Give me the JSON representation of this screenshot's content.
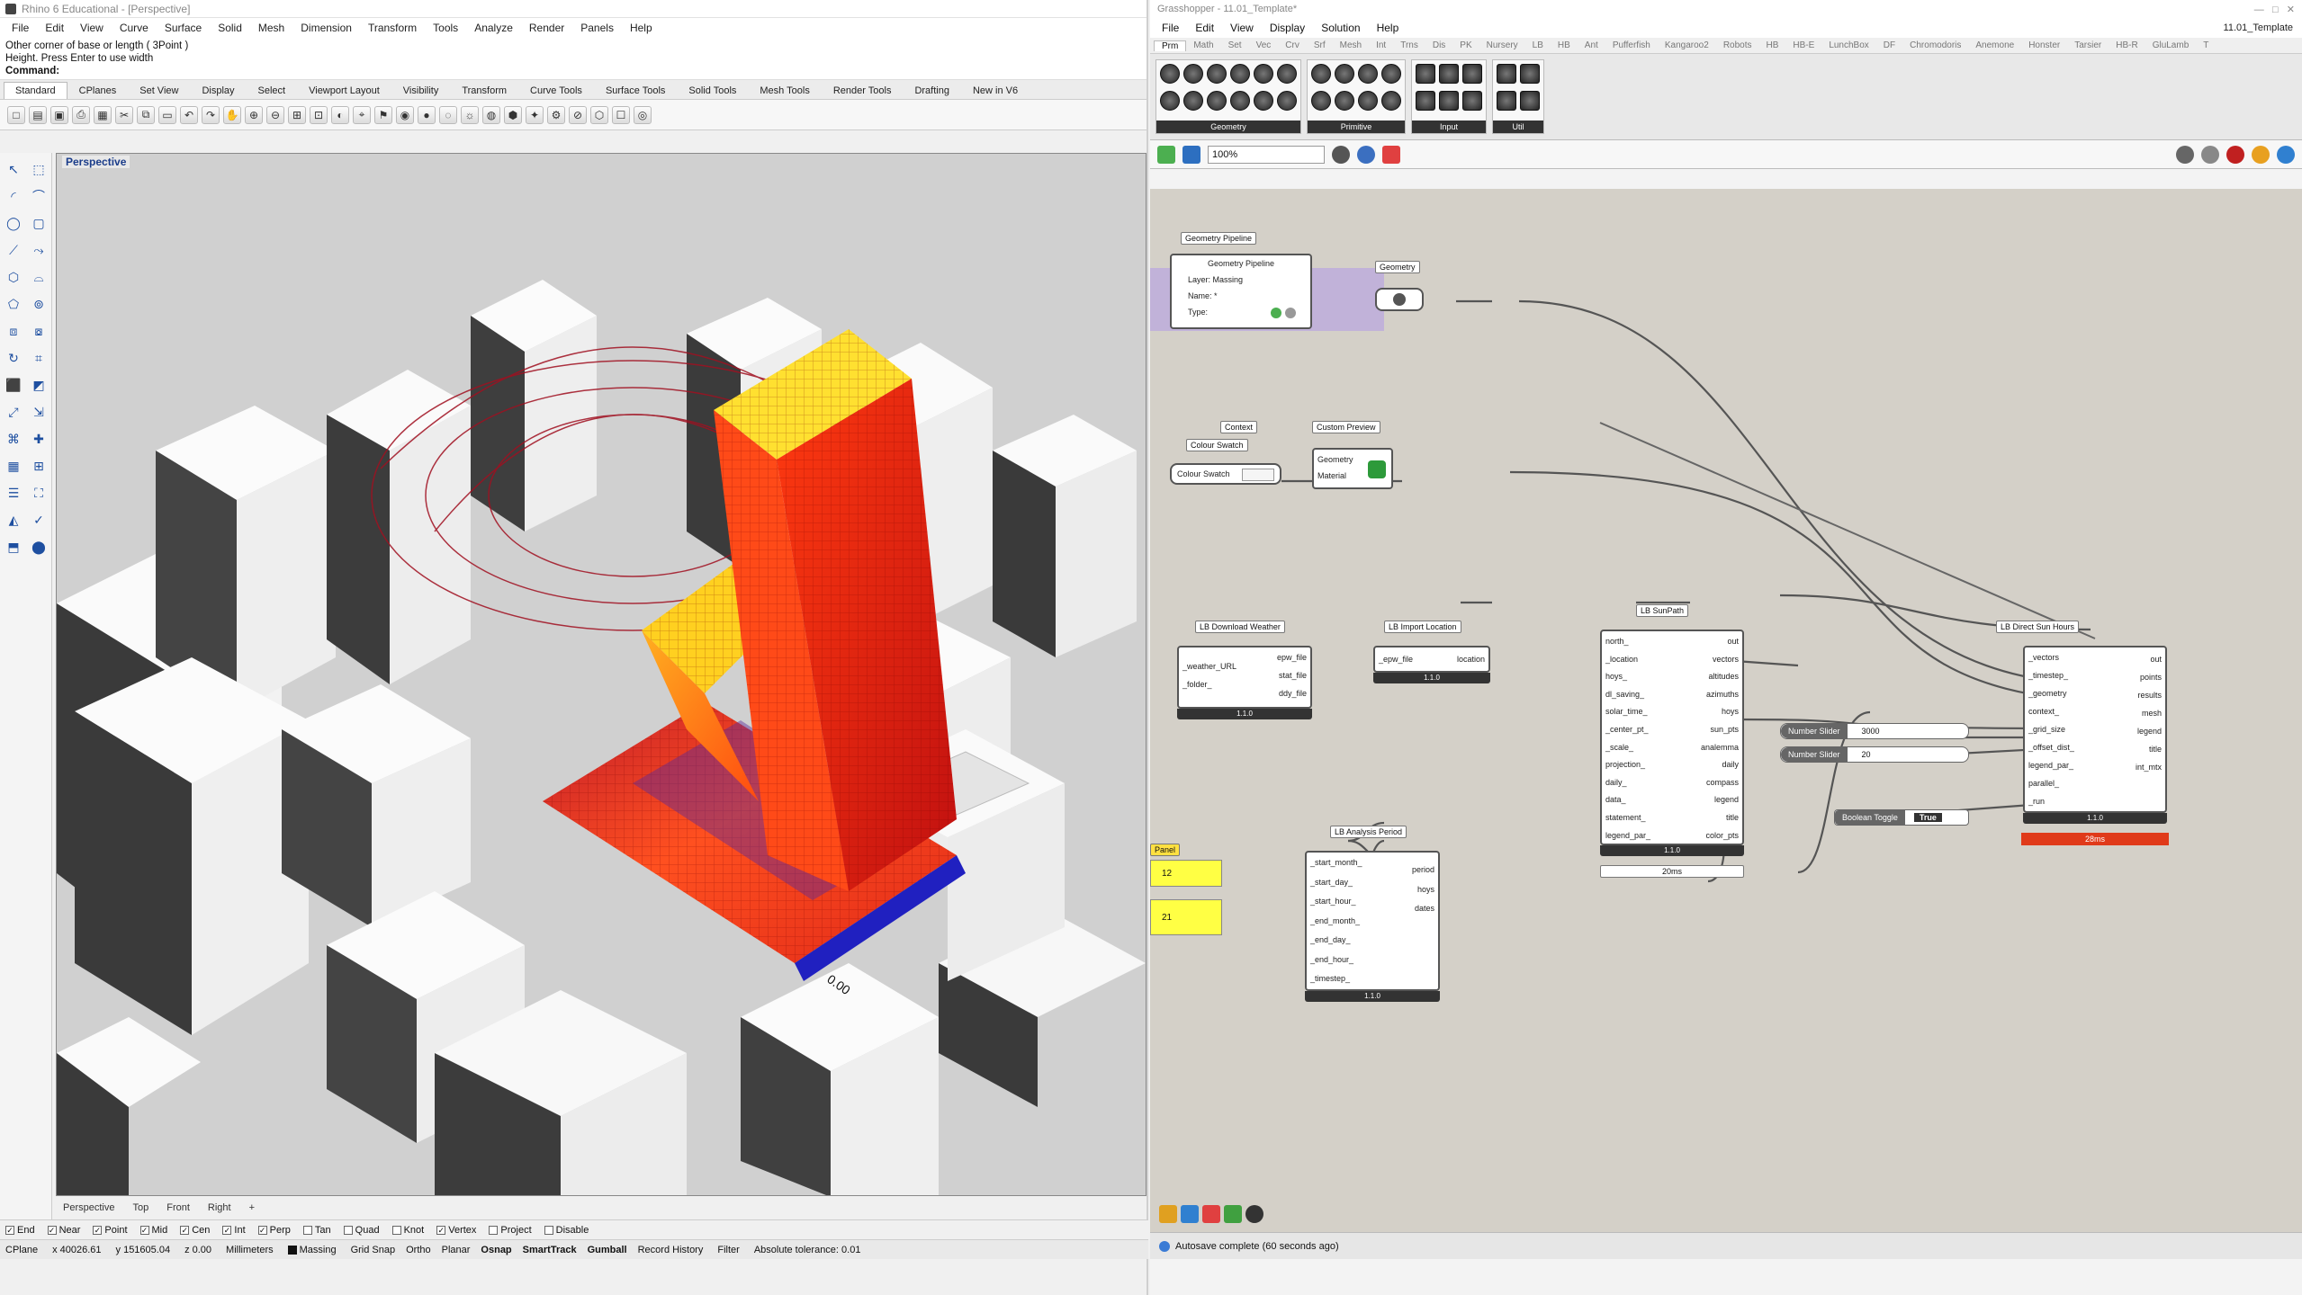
{
  "rhino": {
    "title": "Rhino 6 Educational - [Perspective]",
    "menu": [
      "File",
      "Edit",
      "View",
      "Curve",
      "Surface",
      "Solid",
      "Mesh",
      "Dimension",
      "Transform",
      "Tools",
      "Analyze",
      "Render",
      "Panels",
      "Help"
    ],
    "cmd_lines": [
      "Other corner of base or length ( 3Point )",
      "Height. Press Enter to use width"
    ],
    "cmd_prompt": "Command:",
    "toolbar_tabs": [
      "Standard",
      "CPlanes",
      "Set View",
      "Display",
      "Select",
      "Viewport Layout",
      "Visibility",
      "Transform",
      "Curve Tools",
      "Surface Tools",
      "Solid Tools",
      "Mesh Tools",
      "Render Tools",
      "Drafting",
      "New in V6"
    ],
    "viewport_label": "Perspective",
    "view_tabs": [
      "Perspective",
      "Top",
      "Front",
      "Right"
    ],
    "osnaps": [
      {
        "label": "End",
        "checked": true
      },
      {
        "label": "Near",
        "checked": true
      },
      {
        "label": "Point",
        "checked": true
      },
      {
        "label": "Mid",
        "checked": true
      },
      {
        "label": "Cen",
        "checked": true
      },
      {
        "label": "Int",
        "checked": true
      },
      {
        "label": "Perp",
        "checked": true
      },
      {
        "label": "Tan",
        "checked": false
      },
      {
        "label": "Quad",
        "checked": false
      },
      {
        "label": "Knot",
        "checked": false
      },
      {
        "label": "Vertex",
        "checked": true
      },
      {
        "label": "Project",
        "checked": false
      },
      {
        "label": "Disable",
        "checked": false
      }
    ],
    "status": {
      "cplane": "CPlane",
      "x": "x 40026.61",
      "y": "y 151605.04",
      "z": "z 0.00",
      "units": "Millimeters",
      "layer": "Massing",
      "layer_color": "#111111",
      "items": [
        "Grid Snap",
        "Ortho",
        "Planar",
        "Osnap",
        "SmartTrack",
        "Gumball",
        "Record History"
      ],
      "filter": "Filter",
      "tolerance": "Absolute tolerance: 0.01"
    },
    "scale_label": "0.00"
  },
  "gh": {
    "title": "Grasshopper - 11.01_Template*",
    "doc_name": "11.01_Template",
    "menu": [
      "File",
      "Edit",
      "View",
      "Display",
      "Solution",
      "Help"
    ],
    "tabs": [
      "Prm",
      "Math",
      "Set",
      "Vec",
      "Crv",
      "Srf",
      "Mesh",
      "Int",
      "Trns",
      "Dis",
      "PK",
      "Nursery",
      "LB",
      "HB",
      "Ant",
      "Pufferfish",
      "Kangaroo2",
      "Robots",
      "HB",
      "HB-E",
      "LunchBox",
      "DF",
      "Chromodoris",
      "Anemone",
      "Honster",
      "Tarsier",
      "HB-R",
      "GluLamb",
      "T"
    ],
    "ribbon_groups": [
      "Geometry",
      "Primitive",
      "Input",
      "Util"
    ],
    "zoom": "100%",
    "groups": {
      "geometry_pipeline": "Geometry Pipeline",
      "geometry": "Geometry",
      "context": "Context",
      "colour_swatch": "Colour Swatch",
      "custom_preview": "Custom Preview"
    },
    "geometry_pipeline": {
      "title": "Geometry Pipeline",
      "layer": "Layer: Massing",
      "name": "Name: *",
      "type": "Type:"
    },
    "colour_swatch_label": "Colour Swatch",
    "custom_preview": {
      "inputs": [
        "Geometry",
        "Material"
      ]
    },
    "download_weather": {
      "title": "LB Download Weather",
      "inputs": [
        "_weather_URL",
        "_folder_"
      ],
      "outputs": [
        "epw_file",
        "stat_file",
        "ddy_file"
      ],
      "version": "1.1.0"
    },
    "import_location": {
      "title": "LB Import Location",
      "inputs": [
        "_epw_file"
      ],
      "outputs": [
        "location"
      ],
      "version": "1.1.0"
    },
    "sunpath": {
      "title": "LB SunPath",
      "inputs": [
        "north_",
        "_location",
        "hoys_",
        "dl_saving_",
        "solar_time_",
        "_center_pt_",
        "_scale_",
        "projection_",
        "daily_",
        "data_",
        "statement_",
        "legend_par_"
      ],
      "outputs": [
        "out",
        "vectors",
        "altitudes",
        "azimuths",
        "hoys",
        "sun_pts",
        "analemma",
        "daily",
        "compass",
        "legend",
        "title",
        "color_pts"
      ],
      "version": "1.1.0",
      "time": "20ms"
    },
    "direct_sun": {
      "title": "LB Direct Sun Hours",
      "inputs": [
        "_vectors",
        "_timestep_",
        "_geometry",
        "context_",
        "_grid_size",
        "_offset_dist_",
        "legend_par_",
        "parallel_",
        "_run"
      ],
      "outputs": [
        "out",
        "points",
        "results",
        "mesh",
        "legend",
        "title",
        "int_mtx"
      ],
      "version": "1.1.0",
      "time": "28ms"
    },
    "analysis_period": {
      "title": "LB Analysis Period",
      "inputs": [
        "_start_month_",
        "_start_day_",
        "_start_hour_",
        "_end_month_",
        "_end_day_",
        "_end_hour_",
        "_timestep_"
      ],
      "outputs": [
        "period",
        "hoys",
        "dates"
      ],
      "version": "1.1.0"
    },
    "sliders": [
      {
        "name": "Number Slider",
        "value": "3000"
      },
      {
        "name": "Number Slider",
        "value": "20"
      }
    ],
    "toggle": {
      "name": "Boolean Toggle",
      "value": "True"
    },
    "panel": {
      "title": "Panel",
      "values": [
        "12",
        "21"
      ]
    },
    "status": "Autosave complete (60 seconds ago)"
  }
}
